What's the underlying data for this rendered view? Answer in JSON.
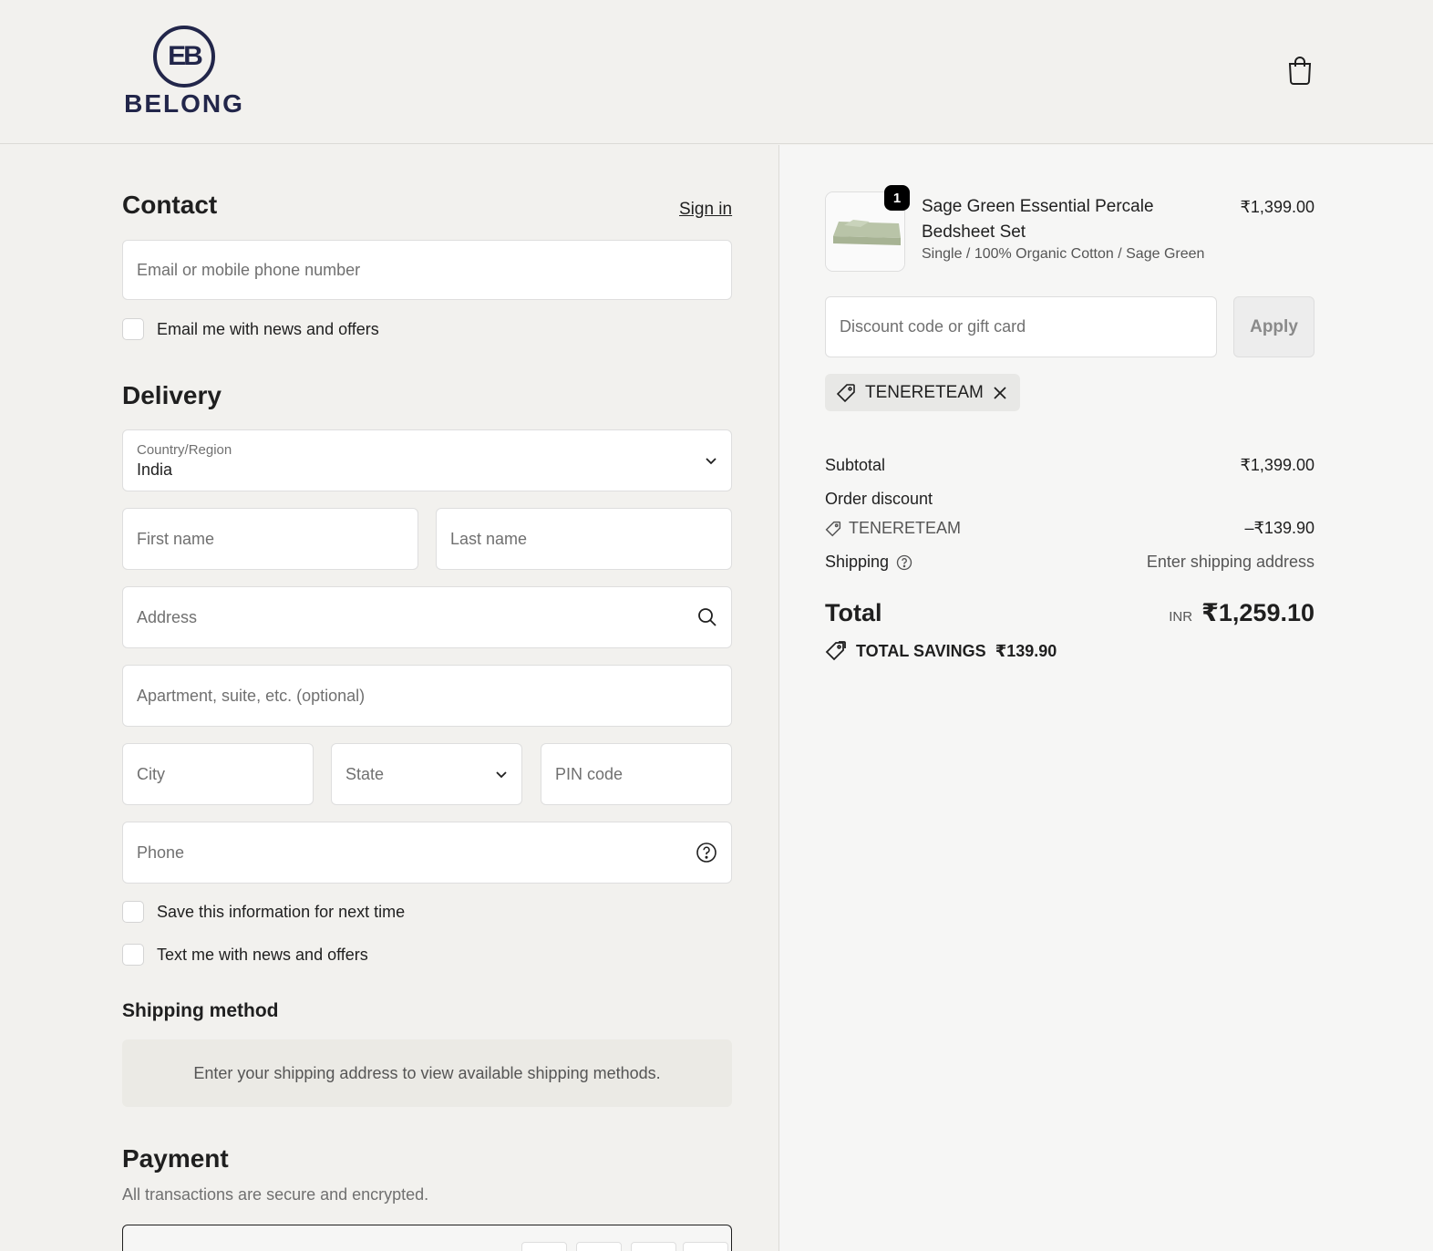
{
  "brand": {
    "mark": "EB",
    "name": "BELONG"
  },
  "watermark_text": "Tenereteam",
  "contact": {
    "title": "Contact",
    "sign_in_label": "Sign in",
    "email_placeholder": "Email or mobile phone number",
    "news_checkbox_label": "Email me with news and offers"
  },
  "delivery": {
    "title": "Delivery",
    "country_label": "Country/Region",
    "country_value": "India",
    "first_name_placeholder": "First name",
    "last_name_placeholder": "Last name",
    "address_placeholder": "Address",
    "apartment_placeholder": "Apartment, suite, etc. (optional)",
    "city_placeholder": "City",
    "state_placeholder": "State",
    "pin_placeholder": "PIN code",
    "phone_placeholder": "Phone",
    "save_info_label": "Save this information for next time",
    "text_offers_label": "Text me with news and offers"
  },
  "shipping_method": {
    "title": "Shipping method",
    "notice": "Enter your shipping address to view available shipping methods."
  },
  "payment": {
    "title": "Payment",
    "subtitle": "All transactions are secure and encrypted."
  },
  "order": {
    "item": {
      "quantity": "1",
      "name": "Sage Green Essential Percale Bedsheet Set",
      "variant": "Single / 100% Organic Cotton / Sage Green",
      "price": "₹1,399.00"
    },
    "discount_placeholder": "Discount code or gift card",
    "apply_label": "Apply",
    "applied_code": "TENERETEAM",
    "subtotal_label": "Subtotal",
    "subtotal_value": "₹1,399.00",
    "order_discount_label": "Order discount",
    "discount_code": "TENERETEAM",
    "discount_value": "–₹139.90",
    "shipping_label": "Shipping",
    "shipping_value": "Enter shipping address",
    "total_label": "Total",
    "currency": "INR",
    "total_value": "₹1,259.10",
    "savings_label": "TOTAL SAVINGS",
    "savings_value": "₹139.90"
  },
  "colors": {
    "brand_navy": "#22264a",
    "page_bg": "#f2f1ee",
    "summary_bg": "#f6f6f5"
  }
}
